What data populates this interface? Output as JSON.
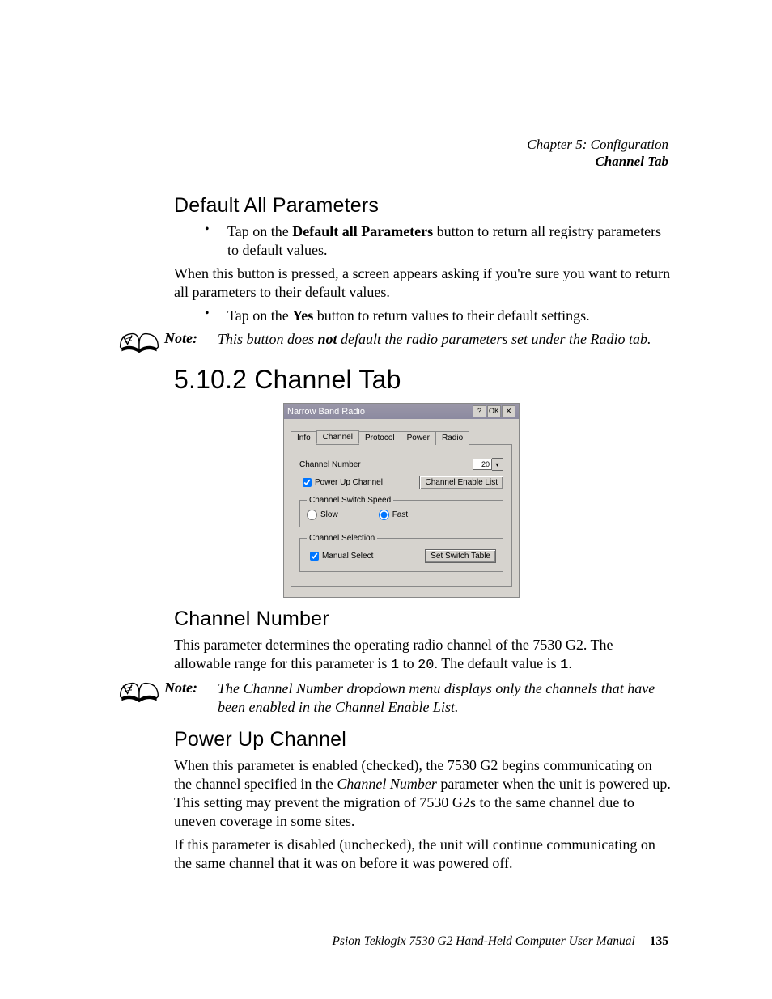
{
  "running_head": {
    "chapter": "Chapter 5: Configuration",
    "section": "Channel Tab"
  },
  "h_default_all": "Default All Parameters",
  "bullet1_pre": "Tap on the ",
  "bullet1_bold": "Default all Parameters",
  "bullet1_post": " button to return all registry parameters to default values.",
  "para1": "When this button is pressed, a screen appears asking if you're sure you want to return all parameters to their default values.",
  "bullet2_pre": "Tap on the ",
  "bullet2_bold": "Yes",
  "bullet2_post": " button to return values to their default settings.",
  "note_label": "Note:",
  "note1_pre": "This button does ",
  "note1_bold": "not",
  "note1_post": " default the radio parameters set under the Radio tab.",
  "h_5_10_2": "5.10.2  Channel Tab",
  "shot": {
    "title": "Narrow Band Radio",
    "btn_help": "?",
    "btn_ok": "OK",
    "btn_close": "✕",
    "tabs": {
      "info": "Info",
      "channel": "Channel",
      "protocol": "Protocol",
      "power": "Power",
      "radio": "Radio"
    },
    "channel_number_label": "Channel Number",
    "channel_number_value": "20",
    "power_up_label": "Power Up Channel",
    "channel_enable_btn": "Channel Enable List",
    "switch_speed_legend": "Channel Switch Speed",
    "slow": "Slow",
    "fast": "Fast",
    "selection_legend": "Channel Selection",
    "manual_select": "Manual Select",
    "set_switch_table": "Set Switch Table"
  },
  "h_channel_number": "Channel Number",
  "cn_p1_a": "This parameter determines the operating radio channel of the 7530 G2. The allowable range for this parameter is ",
  "cn_p1_m1": "1",
  "cn_p1_b": " to ",
  "cn_p1_m2": "20",
  "cn_p1_c": ". The default value is ",
  "cn_p1_m3": "1",
  "cn_p1_d": ".",
  "note2": "The Channel Number dropdown menu displays only the channels that have been enabled in the Channel Enable List.",
  "h_power_up": "Power Up Channel",
  "pu_p1_a": "When this parameter is enabled (checked), the 7530 G2 begins communicating on the channel specified in the ",
  "pu_p1_i": "Channel Number",
  "pu_p1_b": " parameter when the unit is powered up. This setting may prevent the migration of 7530 G2s to the same channel due to uneven coverage in some sites.",
  "pu_p2": "If this parameter is disabled (unchecked), the unit will continue communicating on the same channel that it was on before it was powered off.",
  "footer_text": "Psion Teklogix 7530 G2 Hand-Held Computer User Manual",
  "page_number": "135"
}
